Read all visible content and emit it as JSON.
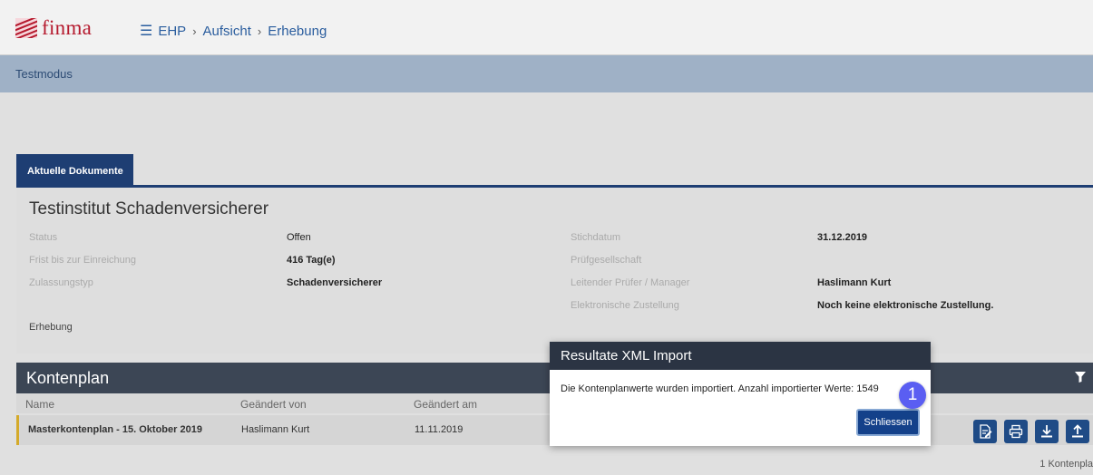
{
  "header": {
    "logo_text": "finma",
    "breadcrumb": [
      "EHP",
      "Aufsicht",
      "Erhebung"
    ],
    "brand_color": "#b5192d"
  },
  "banner": {
    "text": "Testmodus"
  },
  "tabs": [
    {
      "label": "Aktuelle Dokumente",
      "active": true
    }
  ],
  "institution": {
    "title": "Testinstitut Schadenversicherer",
    "left_fields": [
      {
        "label": "Status",
        "value": "Offen"
      },
      {
        "label": "Frist bis zur Einreichung",
        "value": "416 Tag(e)"
      },
      {
        "label": "Zulassungstyp",
        "value": "Schadenversicherer"
      }
    ],
    "right_fields": [
      {
        "label": "Stichdatum",
        "value": "31.12.2019"
      },
      {
        "label": "Prüfgesellschaft",
        "value": ""
      },
      {
        "label": "Leitender Prüfer / Manager",
        "value": "Haslimann Kurt"
      },
      {
        "label": "Elektronische Zustellung",
        "value": "Noch keine elektronische Zustellung."
      }
    ],
    "erhebung_label": "Erhebung"
  },
  "kontenplan": {
    "title": "Kontenplan",
    "columns": [
      "Name",
      "Geändert von",
      "Geändert am"
    ],
    "rows": [
      {
        "name": "Masterkontenplan - 15. Oktober 2019",
        "changed_by": "Haslimann Kurt",
        "changed_on": "11.11.2019"
      }
    ],
    "actions": [
      "edit-document-icon",
      "print-icon",
      "download-icon",
      "upload-icon"
    ],
    "count_text": "1 Kontenpla"
  },
  "modal": {
    "title": "Resultate XML Import",
    "message": "Die Kontenplanwerte wurden importiert. Anzahl importierter Werte: 1549",
    "close_label": "Schliessen"
  },
  "step_badge": "1"
}
